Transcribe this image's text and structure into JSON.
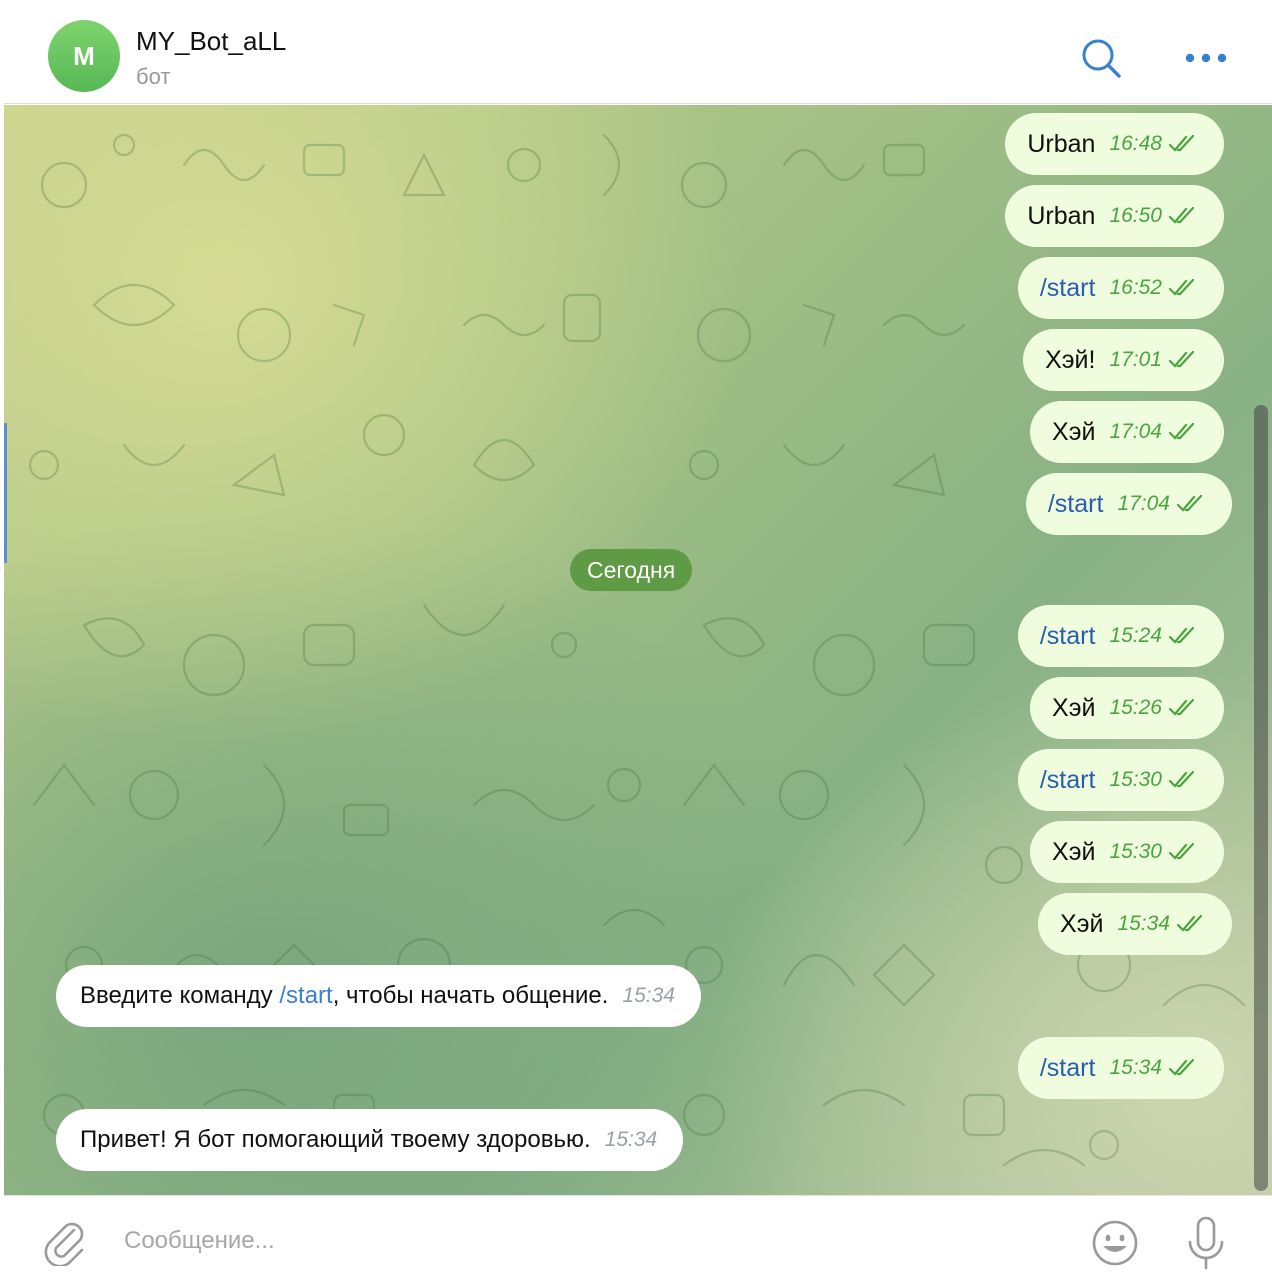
{
  "header": {
    "avatar_letter": "M",
    "title": "MY_Bot_aLL",
    "subtitle": "бот"
  },
  "chat": {
    "date_divider": "Сегодня",
    "outgoing_earlier": [
      {
        "text": "Urban",
        "time": "16:48",
        "is_command": false
      },
      {
        "text": "Urban",
        "time": "16:50",
        "is_command": false
      },
      {
        "text": "/start",
        "time": "16:52",
        "is_command": true
      },
      {
        "text": "Хэй!",
        "time": "17:01",
        "is_command": false
      },
      {
        "text": "Хэй",
        "time": "17:04",
        "is_command": false
      },
      {
        "text": "/start",
        "time": "17:04",
        "is_command": true
      }
    ],
    "outgoing_today": [
      {
        "text": "/start",
        "time": "15:24",
        "is_command": true
      },
      {
        "text": "Хэй",
        "time": "15:26",
        "is_command": false
      },
      {
        "text": "/start",
        "time": "15:30",
        "is_command": true
      },
      {
        "text": "Хэй",
        "time": "15:30",
        "is_command": false
      },
      {
        "text": "Хэй",
        "time": "15:34",
        "is_command": false
      }
    ],
    "incoming_1": {
      "text_before": "Введите команду ",
      "command": "/start",
      "text_after": ", чтобы начать общение.",
      "time": "15:34"
    },
    "outgoing_last": {
      "text": "/start",
      "time": "15:34",
      "is_command": true
    },
    "incoming_2": {
      "text": "Привет! Я бот помогающий твоему здоровью.",
      "time": "15:34"
    }
  },
  "composer": {
    "placeholder": "Сообщение..."
  },
  "icons": {
    "search": "search-icon",
    "more": "more-dots-icon",
    "attach": "paperclip-icon",
    "emoji": "smiley-icon",
    "mic": "microphone-icon",
    "read": "double-check-icon"
  },
  "colors": {
    "accent": "#3a7fd1",
    "outgoing_bubble": "#effdde",
    "outgoing_time": "#4aa53e",
    "date_pill": "#5f9b45",
    "avatar": "#62c05a"
  }
}
